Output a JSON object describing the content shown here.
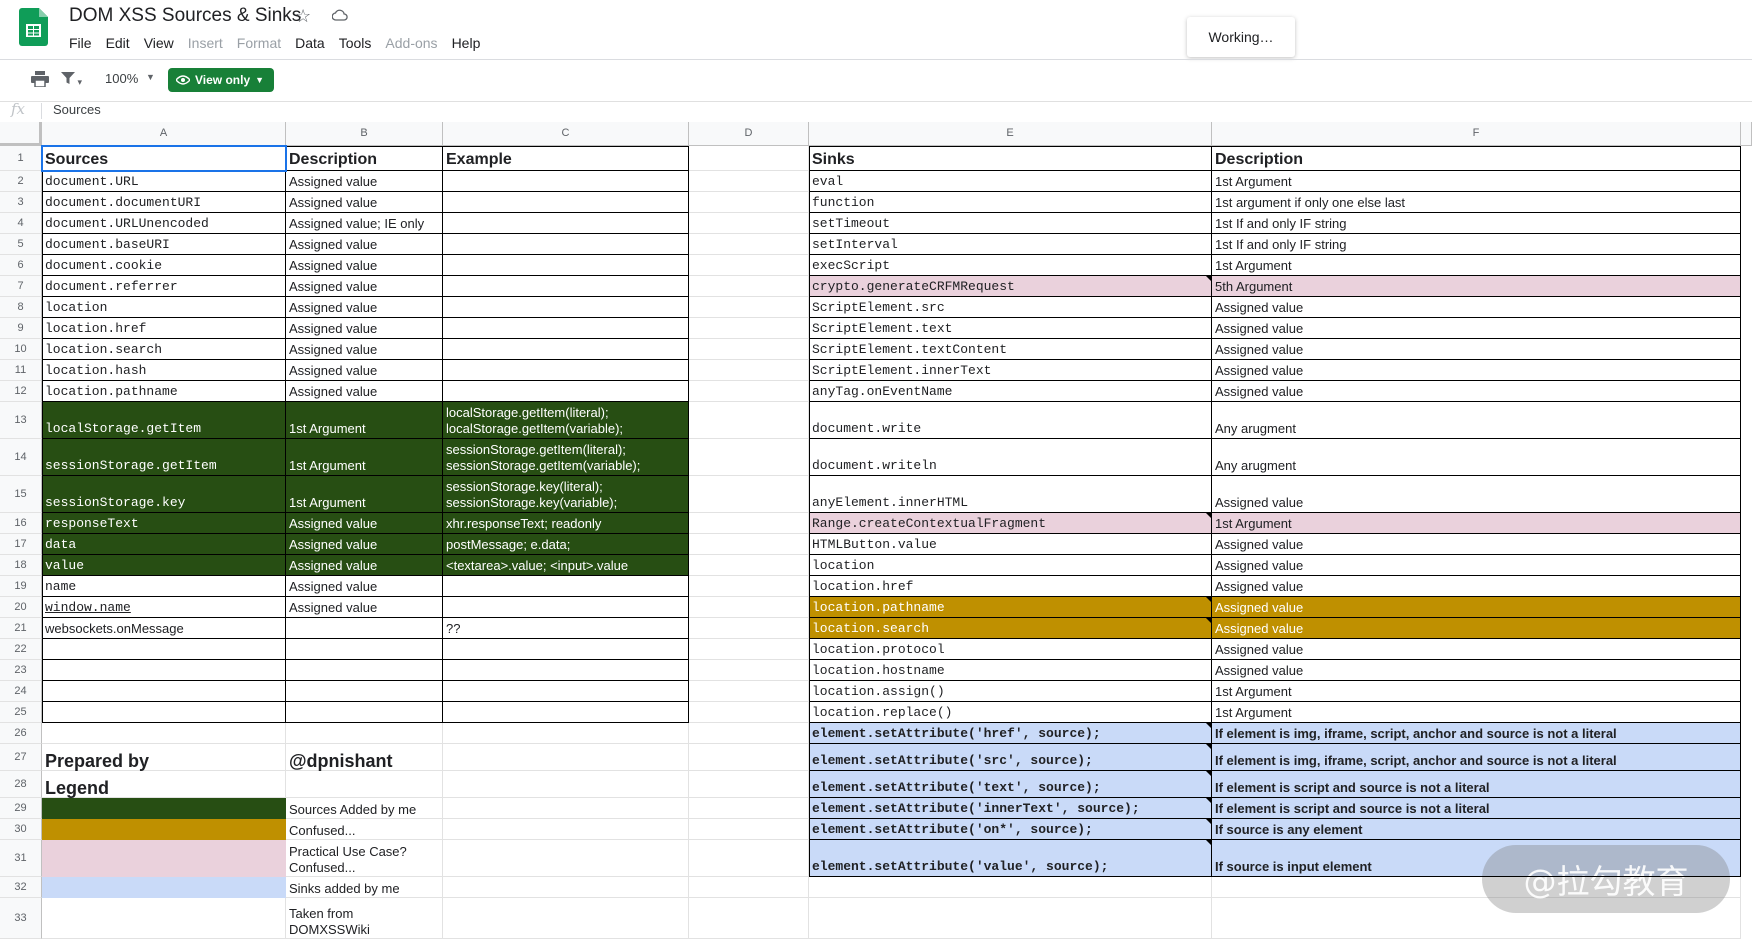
{
  "app": {
    "title": "DOM XSS Sources & Sinks",
    "menu": [
      {
        "label": "File",
        "disabled": false
      },
      {
        "label": "Edit",
        "disabled": false
      },
      {
        "label": "View",
        "disabled": false
      },
      {
        "label": "Insert",
        "disabled": true
      },
      {
        "label": "Format",
        "disabled": true
      },
      {
        "label": "Data",
        "disabled": false
      },
      {
        "label": "Tools",
        "disabled": false
      },
      {
        "label": "Add-ons",
        "disabled": true
      },
      {
        "label": "Help",
        "disabled": false
      }
    ],
    "toast": "Working…",
    "icons": [
      "sheets-logo-icon",
      "star-icon",
      "cloud-status-icon",
      "print-icon",
      "filter-icon",
      "eye-icon",
      "chevron-down-icon"
    ]
  },
  "toolbar": {
    "zoom": "100%",
    "view_only_label": "View only"
  },
  "formula_bar": {
    "fx_label": "fx",
    "content": "Sources"
  },
  "columns": [
    "A",
    "B",
    "C",
    "D",
    "E",
    "F"
  ],
  "row_numbers": [
    "1",
    "2",
    "3",
    "4",
    "5",
    "6",
    "7",
    "8",
    "9",
    "10",
    "11",
    "12",
    "13",
    "14",
    "15",
    "16",
    "17",
    "18",
    "19",
    "20",
    "21",
    "22",
    "23",
    "24",
    "25",
    "26",
    "27",
    "28",
    "29",
    "30",
    "31",
    "32",
    "33"
  ],
  "colors": {
    "green": "#274e13",
    "gold": "#bf9000",
    "pink": "#ead1dc",
    "blue": "#c9daf8",
    "accent": "#188038"
  },
  "cells": [
    {
      "r": 1,
      "c": "A",
      "v": "Sources",
      "s": "hdr"
    },
    {
      "r": 1,
      "c": "B",
      "v": "Description",
      "s": "hdr"
    },
    {
      "r": 1,
      "c": "C",
      "v": "Example",
      "s": "hdr"
    },
    {
      "r": 1,
      "c": "E",
      "v": "Sinks",
      "s": "hdr"
    },
    {
      "r": 1,
      "c": "F",
      "v": "Description",
      "s": "hdr"
    },
    {
      "r": 2,
      "c": "A",
      "v": "document.URL",
      "s": "mono"
    },
    {
      "r": 2,
      "c": "B",
      "v": "Assigned value"
    },
    {
      "r": 3,
      "c": "A",
      "v": "document.documentURI",
      "s": "mono"
    },
    {
      "r": 3,
      "c": "B",
      "v": "Assigned value"
    },
    {
      "r": 4,
      "c": "A",
      "v": "document.URLUnencoded",
      "s": "mono"
    },
    {
      "r": 4,
      "c": "B",
      "v": "Assigned value; IE only"
    },
    {
      "r": 5,
      "c": "A",
      "v": "document.baseURI",
      "s": "mono"
    },
    {
      "r": 5,
      "c": "B",
      "v": "Assigned value"
    },
    {
      "r": 6,
      "c": "A",
      "v": "document.cookie",
      "s": "mono"
    },
    {
      "r": 6,
      "c": "B",
      "v": "Assigned value"
    },
    {
      "r": 7,
      "c": "A",
      "v": "document.referrer",
      "s": "mono"
    },
    {
      "r": 7,
      "c": "B",
      "v": "Assigned value"
    },
    {
      "r": 8,
      "c": "A",
      "v": "location",
      "s": "mono"
    },
    {
      "r": 8,
      "c": "B",
      "v": "Assigned value"
    },
    {
      "r": 9,
      "c": "A",
      "v": "location.href",
      "s": "mono"
    },
    {
      "r": 9,
      "c": "B",
      "v": "Assigned value"
    },
    {
      "r": 10,
      "c": "A",
      "v": "location.search",
      "s": "mono"
    },
    {
      "r": 10,
      "c": "B",
      "v": "Assigned value"
    },
    {
      "r": 11,
      "c": "A",
      "v": "location.hash",
      "s": "mono"
    },
    {
      "r": 11,
      "c": "B",
      "v": "Assigned value"
    },
    {
      "r": 12,
      "c": "A",
      "v": "location.pathname",
      "s": "mono"
    },
    {
      "r": 12,
      "c": "B",
      "v": "Assigned value"
    },
    {
      "r": 13,
      "c": "A",
      "v": "localStorage.getItem",
      "s": "mono",
      "bg": "green"
    },
    {
      "r": 13,
      "c": "B",
      "v": "1st Argument",
      "bg": "green"
    },
    {
      "r": 13,
      "c": "C",
      "v": "localStorage.getItem(literal);\nlocalStorage.getItem(variable);",
      "s": "wrap",
      "bg": "green"
    },
    {
      "r": 14,
      "c": "A",
      "v": "sessionStorage.getItem",
      "s": "mono",
      "bg": "green"
    },
    {
      "r": 14,
      "c": "B",
      "v": "1st Argument",
      "bg": "green"
    },
    {
      "r": 14,
      "c": "C",
      "v": "sessionStorage.getItem(literal);\nsessionStorage.getItem(variable);",
      "s": "wrap",
      "bg": "green"
    },
    {
      "r": 15,
      "c": "A",
      "v": "sessionStorage.key",
      "s": "mono",
      "bg": "green"
    },
    {
      "r": 15,
      "c": "B",
      "v": "1st Argument",
      "bg": "green"
    },
    {
      "r": 15,
      "c": "C",
      "v": "sessionStorage.key(literal);\nsessionStorage.key(variable);",
      "s": "wrap",
      "bg": "green"
    },
    {
      "r": 16,
      "c": "A",
      "v": "responseText",
      "s": "mono",
      "bg": "green"
    },
    {
      "r": 16,
      "c": "B",
      "v": "Assigned value",
      "bg": "green"
    },
    {
      "r": 16,
      "c": "C",
      "v": "xhr.responseText; readonly",
      "bg": "green"
    },
    {
      "r": 17,
      "c": "A",
      "v": "data",
      "s": "mono",
      "bg": "green"
    },
    {
      "r": 17,
      "c": "B",
      "v": "Assigned value",
      "bg": "green"
    },
    {
      "r": 17,
      "c": "C",
      "v": "postMessage; e.data;",
      "bg": "green"
    },
    {
      "r": 18,
      "c": "A",
      "v": "value",
      "s": "mono",
      "bg": "green"
    },
    {
      "r": 18,
      "c": "B",
      "v": "Assigned value",
      "bg": "green"
    },
    {
      "r": 18,
      "c": "C",
      "v": "<textarea>.value; <input>.value",
      "bg": "green"
    },
    {
      "r": 19,
      "c": "A",
      "v": "name",
      "s": "mono"
    },
    {
      "r": 19,
      "c": "B",
      "v": "Assigned value"
    },
    {
      "r": 20,
      "c": "A",
      "v": "window.name",
      "s": "mono",
      "u": true
    },
    {
      "r": 20,
      "c": "B",
      "v": "Assigned value"
    },
    {
      "r": 21,
      "c": "A",
      "v": "websockets.onMessage"
    },
    {
      "r": 21,
      "c": "C",
      "v": "??"
    },
    {
      "r": 2,
      "c": "E",
      "v": "eval",
      "s": "mono"
    },
    {
      "r": 2,
      "c": "F",
      "v": "1st Argument"
    },
    {
      "r": 3,
      "c": "E",
      "v": "function",
      "s": "mono"
    },
    {
      "r": 3,
      "c": "F",
      "v": "1st argument if only one else last"
    },
    {
      "r": 4,
      "c": "E",
      "v": "setTimeout",
      "s": "mono"
    },
    {
      "r": 4,
      "c": "F",
      "v": "1st If and only IF string"
    },
    {
      "r": 5,
      "c": "E",
      "v": "setInterval",
      "s": "mono"
    },
    {
      "r": 5,
      "c": "F",
      "v": "1st If and only IF string"
    },
    {
      "r": 6,
      "c": "E",
      "v": "execScript",
      "s": "mono"
    },
    {
      "r": 6,
      "c": "F",
      "v": "1st Argument"
    },
    {
      "r": 7,
      "c": "E",
      "v": "crypto.generateCRFMRequest",
      "s": "mono",
      "bg": "pink",
      "tri": true
    },
    {
      "r": 7,
      "c": "F",
      "v": "5th Argument",
      "bg": "pink"
    },
    {
      "r": 8,
      "c": "E",
      "v": "ScriptElement.src",
      "s": "mono"
    },
    {
      "r": 8,
      "c": "F",
      "v": "Assigned value"
    },
    {
      "r": 9,
      "c": "E",
      "v": "ScriptElement.text",
      "s": "mono"
    },
    {
      "r": 9,
      "c": "F",
      "v": "Assigned value"
    },
    {
      "r": 10,
      "c": "E",
      "v": "ScriptElement.textContent",
      "s": "mono"
    },
    {
      "r": 10,
      "c": "F",
      "v": "Assigned value"
    },
    {
      "r": 11,
      "c": "E",
      "v": "ScriptElement.innerText",
      "s": "mono"
    },
    {
      "r": 11,
      "c": "F",
      "v": "Assigned value"
    },
    {
      "r": 12,
      "c": "E",
      "v": "anyTag.onEventName",
      "s": "mono"
    },
    {
      "r": 12,
      "c": "F",
      "v": "Assigned value"
    },
    {
      "r": 13,
      "c": "E",
      "v": "document.write",
      "s": "mono"
    },
    {
      "r": 13,
      "c": "F",
      "v": "Any arugment"
    },
    {
      "r": 14,
      "c": "E",
      "v": "document.writeln",
      "s": "mono"
    },
    {
      "r": 14,
      "c": "F",
      "v": "Any arugment"
    },
    {
      "r": 15,
      "c": "E",
      "v": "anyElement.innerHTML",
      "s": "mono"
    },
    {
      "r": 15,
      "c": "F",
      "v": "Assigned value"
    },
    {
      "r": 16,
      "c": "E",
      "v": "Range.createContextualFragment",
      "s": "mono",
      "bg": "pink",
      "tri": true
    },
    {
      "r": 16,
      "c": "F",
      "v": "1st Argument",
      "bg": "pink"
    },
    {
      "r": 17,
      "c": "E",
      "v": "HTMLButton.value",
      "s": "mono"
    },
    {
      "r": 17,
      "c": "F",
      "v": "Assigned value"
    },
    {
      "r": 18,
      "c": "E",
      "v": "location",
      "s": "mono"
    },
    {
      "r": 18,
      "c": "F",
      "v": "Assigned value"
    },
    {
      "r": 19,
      "c": "E",
      "v": "location.href",
      "s": "mono"
    },
    {
      "r": 19,
      "c": "F",
      "v": "Assigned value"
    },
    {
      "r": 20,
      "c": "E",
      "v": "location.pathname",
      "s": "mono",
      "bg": "gold",
      "tri": true
    },
    {
      "r": 20,
      "c": "F",
      "v": "Assigned value",
      "bg": "gold"
    },
    {
      "r": 21,
      "c": "E",
      "v": "location.search",
      "s": "mono",
      "bg": "gold",
      "tri": true
    },
    {
      "r": 21,
      "c": "F",
      "v": "Assigned value",
      "bg": "gold"
    },
    {
      "r": 22,
      "c": "E",
      "v": "location.protocol",
      "s": "mono"
    },
    {
      "r": 22,
      "c": "F",
      "v": "Assigned value"
    },
    {
      "r": 23,
      "c": "E",
      "v": "location.hostname",
      "s": "mono"
    },
    {
      "r": 23,
      "c": "F",
      "v": "Assigned value"
    },
    {
      "r": 24,
      "c": "E",
      "v": "location.assign()",
      "s": "mono"
    },
    {
      "r": 24,
      "c": "F",
      "v": "1st Argument"
    },
    {
      "r": 25,
      "c": "E",
      "v": "location.replace()",
      "s": "mono"
    },
    {
      "r": 25,
      "c": "F",
      "v": "1st Argument"
    },
    {
      "r": 26,
      "c": "E",
      "v": "element.setAttribute('href', source);",
      "s": "mono bold",
      "bg": "blue",
      "tri": true
    },
    {
      "r": 26,
      "c": "F",
      "v": "If element is img, iframe, script, anchor and source is not a literal",
      "s": "bold",
      "bg": "blue"
    },
    {
      "r": 27,
      "c": "E",
      "v": "element.setAttribute('src', source);",
      "s": "mono bold",
      "bg": "blue",
      "tri": true
    },
    {
      "r": 27,
      "c": "F",
      "v": "If element is img, iframe, script, anchor and source is not a literal",
      "s": "bold",
      "bg": "blue"
    },
    {
      "r": 28,
      "c": "E",
      "v": "element.setAttribute('text', source);",
      "s": "mono bold",
      "bg": "blue",
      "tri": true
    },
    {
      "r": 28,
      "c": "F",
      "v": "If element is script and source is not a literal",
      "s": "bold",
      "bg": "blue"
    },
    {
      "r": 29,
      "c": "E",
      "v": "element.setAttribute('innerText', source);",
      "s": "mono bold",
      "bg": "blue",
      "tri": true
    },
    {
      "r": 29,
      "c": "F",
      "v": "If element is script and source is not a literal",
      "s": "bold",
      "bg": "blue"
    },
    {
      "r": 30,
      "c": "E",
      "v": "element.setAttribute('on*', source);",
      "s": "mono bold",
      "bg": "blue",
      "tri": true
    },
    {
      "r": 30,
      "c": "F",
      "v": "If source is any element",
      "s": "bold",
      "bg": "blue"
    },
    {
      "r": 31,
      "c": "E",
      "v": "element.setAttribute('value', source);",
      "s": "mono bold",
      "bg": "blue",
      "tri": true
    },
    {
      "r": 31,
      "c": "F",
      "v": "If source is input element",
      "s": "bold",
      "bg": "blue"
    },
    {
      "r": 27,
      "c": "A",
      "v": "Prepared by",
      "s": "big"
    },
    {
      "r": 27,
      "c": "B",
      "v": "@dpnishant",
      "s": "big"
    },
    {
      "r": 28,
      "c": "A",
      "v": "Legend",
      "s": "big"
    },
    {
      "r": 29,
      "c": "A",
      "v": "",
      "bg": "green"
    },
    {
      "r": 29,
      "c": "B",
      "v": " Sources Added by me"
    },
    {
      "r": 30,
      "c": "A",
      "v": "",
      "bg": "gold"
    },
    {
      "r": 30,
      "c": "B",
      "v": "Confused..."
    },
    {
      "r": 31,
      "c": "A",
      "v": "",
      "bg": "pink"
    },
    {
      "r": 31,
      "c": "B",
      "v": "Practical Use Case?\nConfused...",
      "s": "wrap"
    },
    {
      "r": 32,
      "c": "A",
      "v": "",
      "bg": "blue"
    },
    {
      "r": 32,
      "c": "B",
      "v": "Sinks added by me"
    },
    {
      "r": 33,
      "c": "B",
      "v": "Taken from\nDOMXSSWiki",
      "s": "wrap"
    }
  ],
  "watermark": "@拉勾教育"
}
